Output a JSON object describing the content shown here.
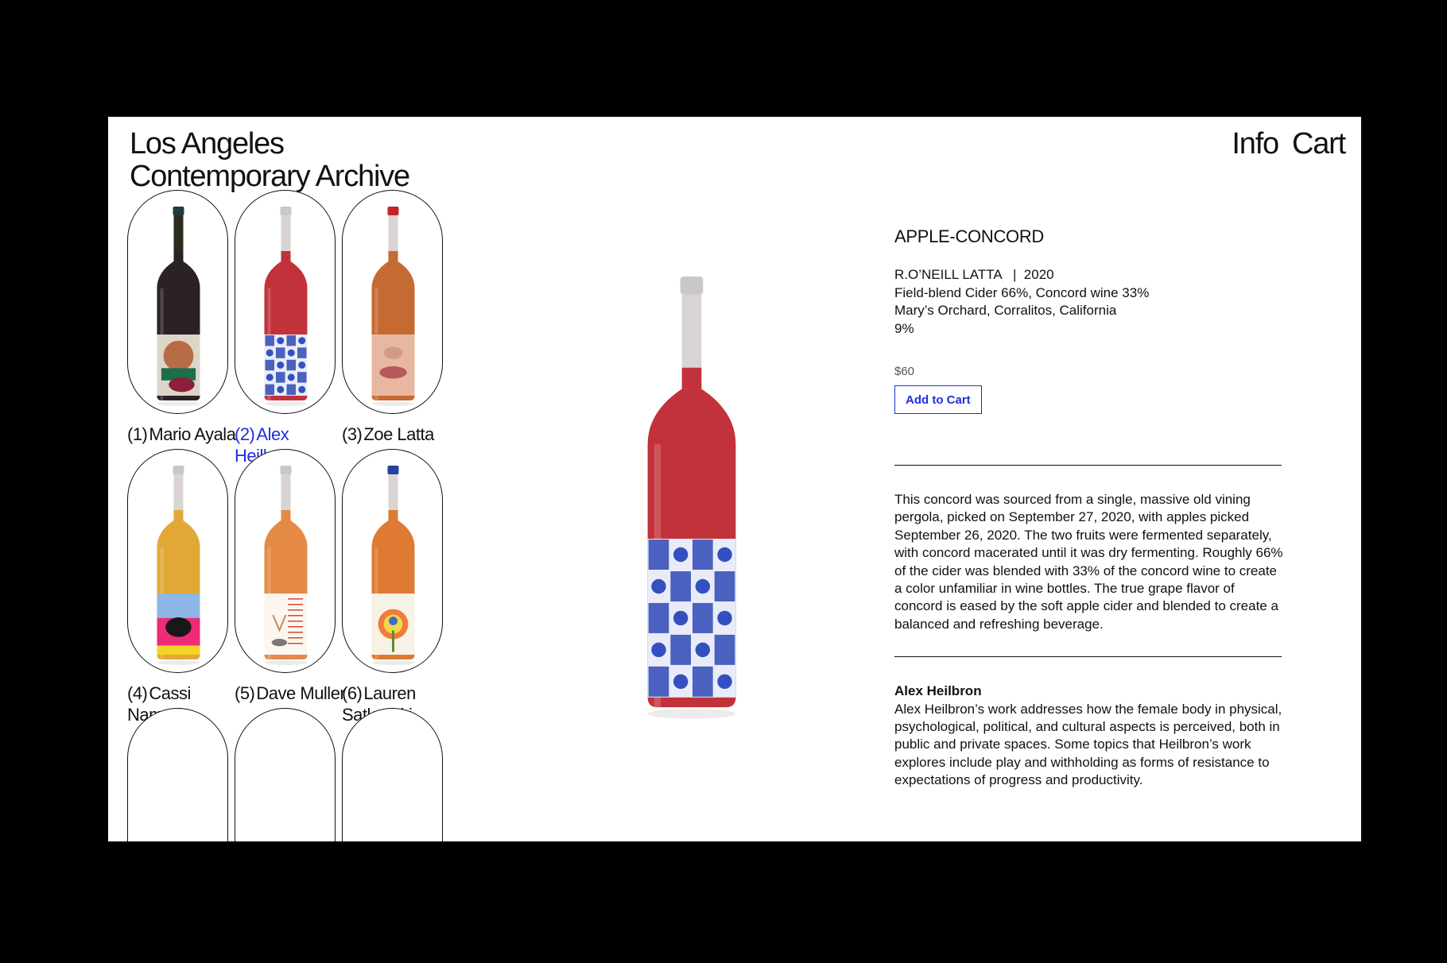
{
  "site": {
    "title_line1": "Los Angeles",
    "title_line2": "Contemporary Archive"
  },
  "nav": {
    "info": "Info",
    "cart": "Cart"
  },
  "artists": [
    {
      "num": "(1)",
      "name": "Mario Ayala",
      "active": false,
      "glass": "#2c2a1a",
      "liquid": "#2a2224",
      "cap": "#1f3a40",
      "label": "collage"
    },
    {
      "num": "(2)",
      "name": "Alex Heilbron",
      "active": true,
      "glass": "#d9d3d3",
      "liquid": "#c2323a",
      "cap": "#c8c8c8",
      "label": "blue-tiles"
    },
    {
      "num": "(3)",
      "name": "Zoe Latta",
      "active": false,
      "glass": "#d9d3d3",
      "liquid": "#c66a33",
      "cap": "#c1262d",
      "label": "lips"
    },
    {
      "num": "(4)",
      "name": "Cassi Namoda",
      "active": false,
      "glass": "#d9d3d3",
      "liquid": "#e2a836",
      "cap": "#c8c8c8",
      "label": "painting"
    },
    {
      "num": "(5)",
      "name": "Dave Muller",
      "active": false,
      "glass": "#d9d3d3",
      "liquid": "#e58a46",
      "cap": "#c8c8c8",
      "label": "text"
    },
    {
      "num": "(6)",
      "name": "Lauren Satlowski",
      "active": false,
      "glass": "#d9d3d3",
      "liquid": "#df7a33",
      "cap": "#27409a",
      "label": "floral"
    }
  ],
  "product": {
    "title": "APPLE-CONCORD",
    "producer_line": "R.O’NEILL LATTA   |  2020",
    "blend": "Field-blend Cider 66%, Concord wine 33%",
    "origin": "Mary’s Orchard, Corralitos, California",
    "abv": "9%",
    "price": "$60",
    "add_to_cart": "Add to Cart",
    "description": "This concord was sourced from a single, massive old vining pergola, picked on September 27, 2020, with apples picked September 26, 2020. The two fruits were fermented separately, with concord macerated until it was dry fermenting. Roughly 66% of the cider was blended with 33% of the concord wine to create a color unfamiliar in wine bottles. The true grape flavor of concord is eased by the soft apple cider and blended to create a balanced and refreshing beverage.",
    "artist_name": "Alex Heilbron",
    "artist_bio": "Alex Heilbron’s work addresses how the female body in physical, psychological, political, and cultural aspects is perceived, both in public and private spaces. Some topics that Heilbron’s work explores include play and withholding as forms of resistance to expectations of progress and productivity."
  },
  "colors": {
    "accent_blue": "#1f2de0",
    "background": "#ffffff",
    "outer_frame": "#000000"
  }
}
